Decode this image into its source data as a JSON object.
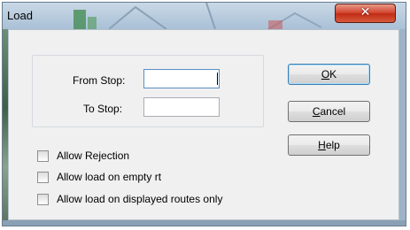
{
  "window": {
    "title": "Load",
    "close_icon": "close-icon"
  },
  "form": {
    "from_stop_label": "From Stop:",
    "from_stop_value": "",
    "to_stop_label": "To Stop:",
    "to_stop_value": ""
  },
  "buttons": {
    "ok": {
      "accel": "O",
      "rest": "K"
    },
    "cancel": {
      "accel": "C",
      "rest": "ancel"
    },
    "help": {
      "accel": "H",
      "rest": "elp"
    }
  },
  "options": [
    {
      "label": "Allow Rejection",
      "checked": false
    },
    {
      "label": "Allow load on empty rt",
      "checked": false
    },
    {
      "label": "Allow load on displayed routes only",
      "checked": false
    }
  ],
  "colors": {
    "close_button": "#c7381f",
    "default_button_border": "#3c7fb1"
  }
}
